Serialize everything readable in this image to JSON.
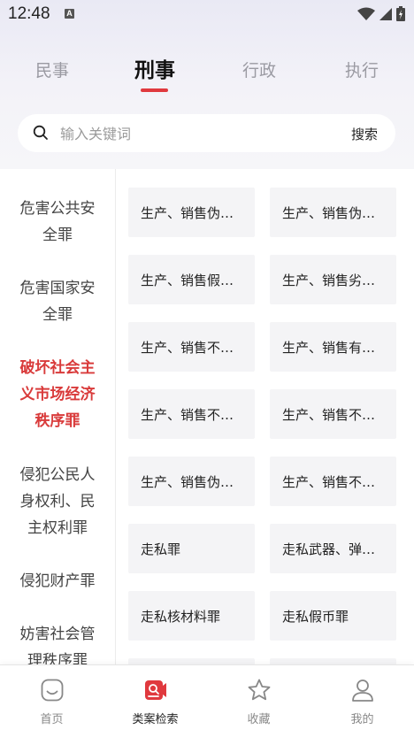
{
  "status_bar": {
    "time": "12:48",
    "notification_letter": "A"
  },
  "tabs": [
    {
      "label": "民事",
      "active": false
    },
    {
      "label": "刑事",
      "active": true
    },
    {
      "label": "行政",
      "active": false
    },
    {
      "label": "执行",
      "active": false
    }
  ],
  "search": {
    "placeholder": "输入关键词",
    "value": "",
    "button_label": "搜索"
  },
  "sidebar": {
    "items": [
      {
        "label": "危害公共安全罪",
        "active": false
      },
      {
        "label": "危害国家安全罪",
        "active": false
      },
      {
        "label": "破坏社会主义市场经济秩序罪",
        "active": true
      },
      {
        "label": "侵犯公民人身权利、民主权利罪",
        "active": false
      },
      {
        "label": "侵犯财产罪",
        "active": false
      },
      {
        "label": "妨害社会管理秩序罪",
        "active": false
      }
    ]
  },
  "grid": {
    "items": [
      "生产、销售伪…",
      "生产、销售伪…",
      "生产、销售假…",
      "生产、销售劣…",
      "生产、销售不…",
      "生产、销售有…",
      "生产、销售不…",
      "生产、销售不…",
      "生产、销售伪…",
      "生产、销售不…",
      "走私罪",
      "走私武器、弹…",
      "走私核材料罪",
      "走私假币罪",
      "",
      ""
    ]
  },
  "bottom_nav": {
    "items": [
      {
        "label": "首页",
        "icon": "home-icon",
        "active": false
      },
      {
        "label": "类案检索",
        "icon": "case-search-icon",
        "active": true
      },
      {
        "label": "收藏",
        "icon": "star-icon",
        "active": false
      },
      {
        "label": "我的",
        "icon": "user-icon",
        "active": false
      }
    ]
  },
  "colors": {
    "accent": "#e0393e",
    "active_sidebar_text": "#d93b3b"
  }
}
